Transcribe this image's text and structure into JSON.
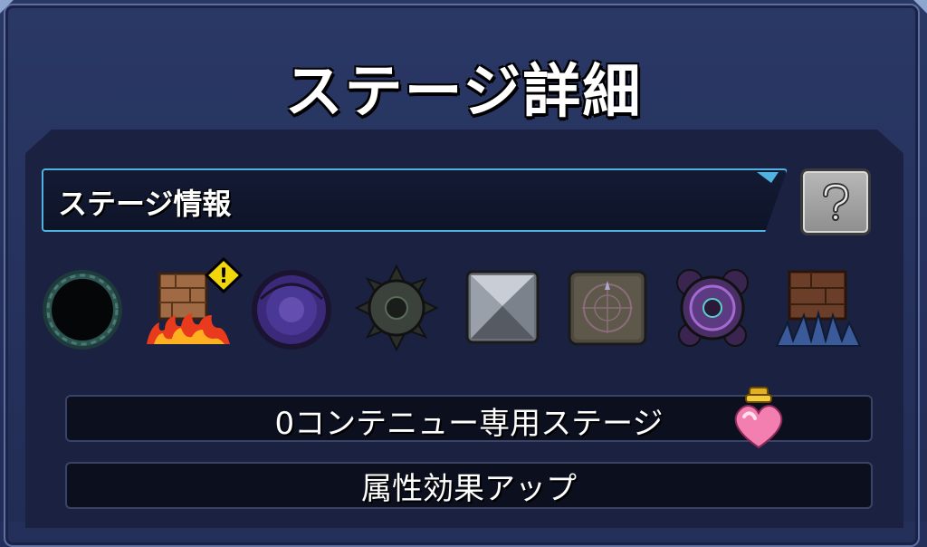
{
  "title": "ステージ詳細",
  "info_bar": {
    "label": "ステージ情報"
  },
  "help_button": {
    "icon": "question-icon"
  },
  "gimmicks": [
    {
      "name": "dark-wormhole-icon"
    },
    {
      "name": "block-damage-wall-icon",
      "warning": "!"
    },
    {
      "name": "purple-warp-icon"
    },
    {
      "name": "spiked-mine-icon"
    },
    {
      "name": "stone-block-icon"
    },
    {
      "name": "magic-circle-panel-icon"
    },
    {
      "name": "gravity-barrier-icon"
    },
    {
      "name": "damage-wall-icon"
    }
  ],
  "conditions": [
    {
      "text": "0コンテニュー専用ステージ",
      "icon": "heart-potion-icon"
    },
    {
      "text": "属性効果アップ"
    }
  ],
  "colors": {
    "background": "#24305a",
    "panel": "#1a2141",
    "accent_border": "#4fb2e0",
    "warning": "#f2d60c"
  }
}
